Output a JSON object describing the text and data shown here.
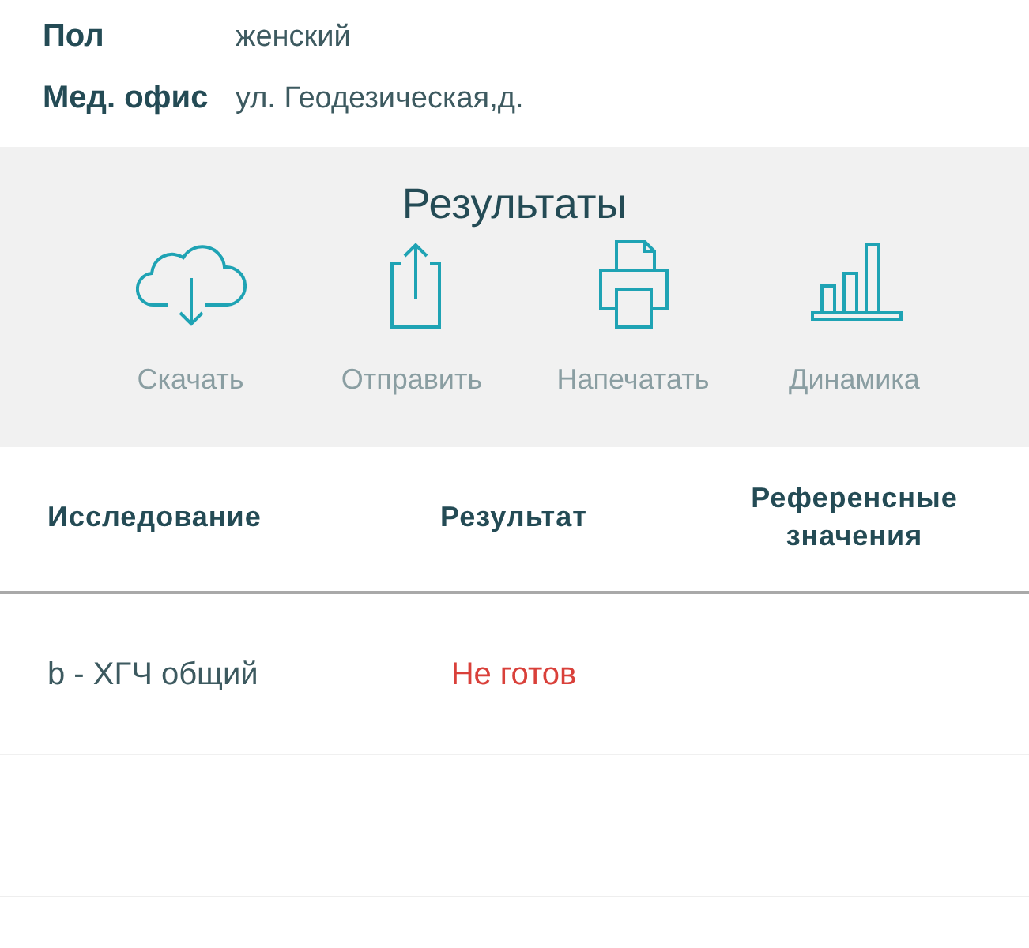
{
  "patient_info": [
    {
      "label": "Пол",
      "value": "женский"
    },
    {
      "label": "Мед. офис",
      "value": "ул. Геодезическая,д."
    }
  ],
  "results_panel": {
    "title": "Результаты",
    "actions": [
      {
        "label": "Скачать"
      },
      {
        "label": "Отправить"
      },
      {
        "label": "Напечатать"
      },
      {
        "label": "Динамика"
      }
    ]
  },
  "table": {
    "columns": [
      "Исследование",
      "Результат",
      "Референсные значения"
    ],
    "rows": [
      {
        "study": "b - ХГЧ общий",
        "result": "Не готов",
        "kind": "pending"
      }
    ]
  }
}
